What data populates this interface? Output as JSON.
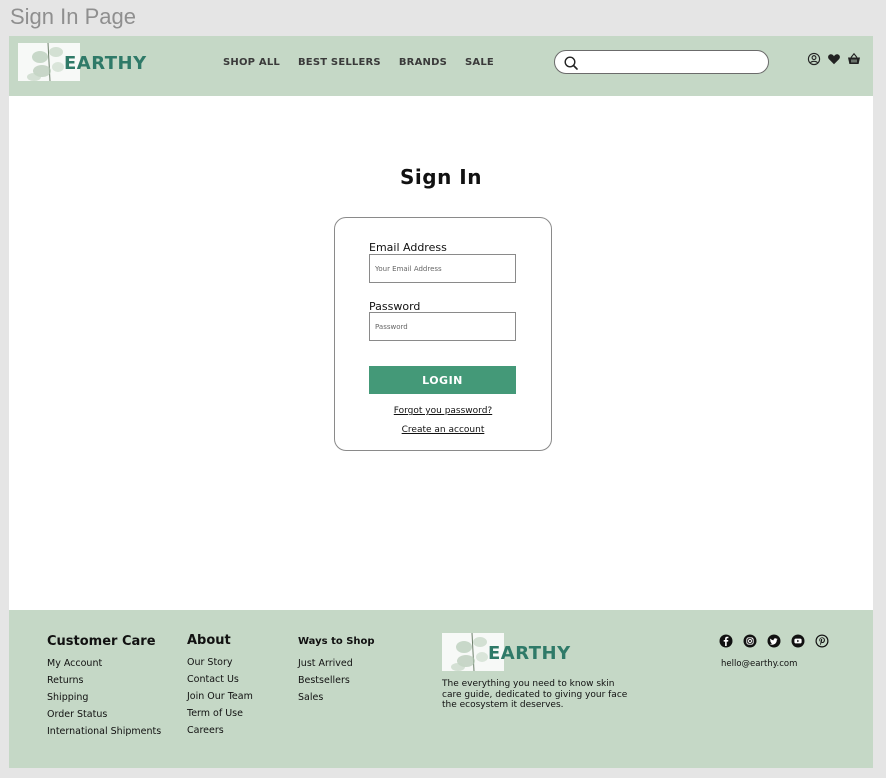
{
  "frame": {
    "title": "Sign In Page"
  },
  "header": {
    "logo_text": "EARTHY",
    "nav": [
      "SHOP ALL",
      "BEST SELLERS",
      "BRANDS",
      "SALE"
    ],
    "search": {
      "value": "",
      "placeholder": ""
    },
    "icons": [
      "account-icon",
      "heart-icon",
      "basket-icon"
    ]
  },
  "signin": {
    "title": "Sign In",
    "email_label": "Email Address",
    "email_placeholder": "Your Email Address",
    "password_label": "Password",
    "password_placeholder": "Password",
    "login_label": "LOGIN",
    "forgot_label": "Forgot you password?",
    "create_label": "Create an account"
  },
  "footer": {
    "customer_care": {
      "heading": "Customer Care",
      "items": [
        "My Account",
        "Returns",
        "Shipping",
        "Order Status",
        "International Shipments"
      ]
    },
    "about": {
      "heading": "About",
      "items": [
        "Our Story",
        "Contact Us",
        "Join Our Team",
        "Term of Use",
        "Careers"
      ]
    },
    "ways_to_shop": {
      "heading": "Ways to Shop",
      "items": [
        "Just Arrived",
        "Bestsellers",
        "Sales"
      ]
    },
    "logo_text": "EARTHY",
    "tagline": "The everything you need to know skin care guide, dedicated to giving your face the ecosystem it deserves.",
    "social": [
      "facebook-icon",
      "instagram-icon",
      "twitter-icon",
      "youtube-icon",
      "pinterest-icon"
    ],
    "email": "hello@earthy.com"
  },
  "colors": {
    "header_bg": "#c5d8c6",
    "brand_text": "#2f7a68",
    "button": "#449978",
    "canvas": "#e5e5e5"
  }
}
